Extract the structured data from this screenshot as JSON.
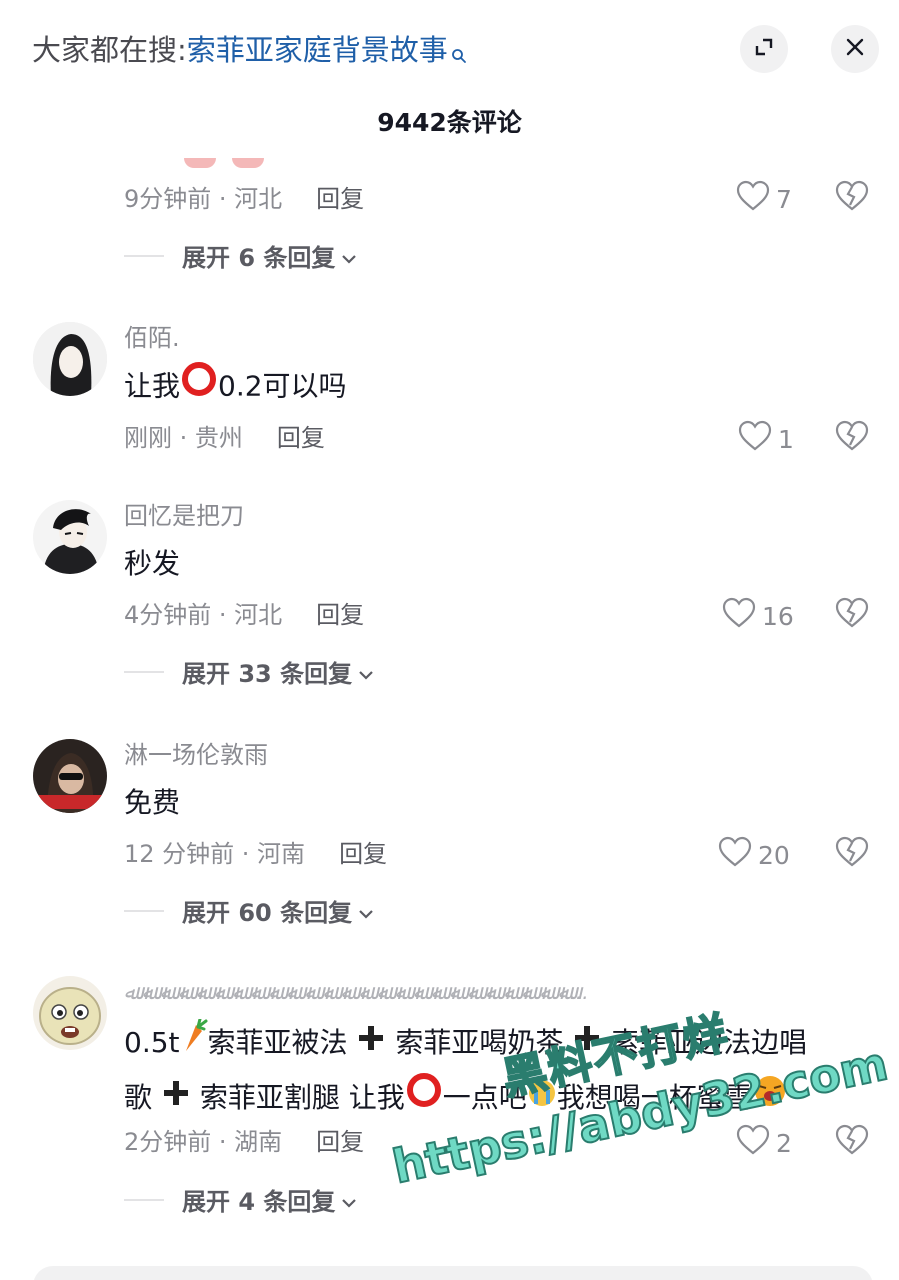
{
  "header": {
    "search_prefix": "大家都在搜:",
    "search_query": "索菲亚家庭背景故事",
    "expand_icon": "expand-icon",
    "close_icon": "close-icon"
  },
  "comments_title": "9442条评论",
  "comments": [
    {
      "meta_time": "9分钟前 · 河北",
      "reply_label": "回复",
      "likes": "7",
      "expand_label": "展开 6 条回复"
    },
    {
      "username": "佰陌.",
      "text_before": "让我",
      "text_after": "0.2可以吗",
      "meta_time": "刚刚 · 贵州",
      "reply_label": "回复",
      "likes": "1"
    },
    {
      "username": "回忆是把刀",
      "text": "秒发",
      "meta_time": "4分钟前 · 河北",
      "reply_label": "回复",
      "likes": "16",
      "expand_label": "展开 33 条回复"
    },
    {
      "username": "淋一场伦敦雨",
      "text": "免费",
      "meta_time": "12 分钟前 · 河南",
      "reply_label": "回复",
      "likes": "20",
      "expand_label": "展开 60 条回复"
    },
    {
      "username": "ﷲ ﷲ ﷲ ﷲ ﷲ ﷲ ﷲ ﷲ ﷲ ﷲ ﷲ ﷲ ﷲ ﷲ ﷲ ﷲ ﷲ ﷲ ﷲ ﷲ ﷲ ﷲ ﷲ ﷲ ﷲ...",
      "line1_a": "0.5t",
      "line1_b": "索菲亚被法",
      "line1_c": "索菲亚喝奶茶",
      "line1_d": "索菲亚边法边唱",
      "line2_a": "歌",
      "line2_b": "索菲亚割腿 让我",
      "line2_c": "一点吧",
      "line2_d": "我想喝一杯蜜雪",
      "meta_time": "2分钟前 · 湖南",
      "reply_label": "回复",
      "likes": "2",
      "expand_label": "展开 4 条回复"
    }
  ],
  "watermark": {
    "line1": "黑料不打烊",
    "line2": "https://abdy32.com"
  },
  "colors": {
    "accent_link": "#1f5fa8",
    "meta_gray": "#8a8b91",
    "circle_red": "#e02020"
  }
}
